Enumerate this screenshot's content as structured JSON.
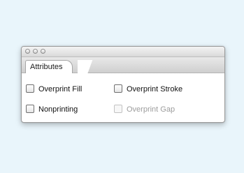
{
  "window": {
    "buttons": [
      "close",
      "minimize",
      "zoom"
    ]
  },
  "tab": {
    "label": "Attributes"
  },
  "options": [
    {
      "label": "Overprint Fill",
      "checked": false,
      "enabled": true
    },
    {
      "label": "Overprint Stroke",
      "checked": false,
      "enabled": true
    },
    {
      "label": "Nonprinting",
      "checked": false,
      "enabled": true
    },
    {
      "label": "Overprint Gap",
      "checked": false,
      "enabled": false
    }
  ],
  "colors": {
    "backdrop": "#e9f5fb",
    "panel": "#ffffff",
    "disabled_text": "#9c9c9c"
  }
}
